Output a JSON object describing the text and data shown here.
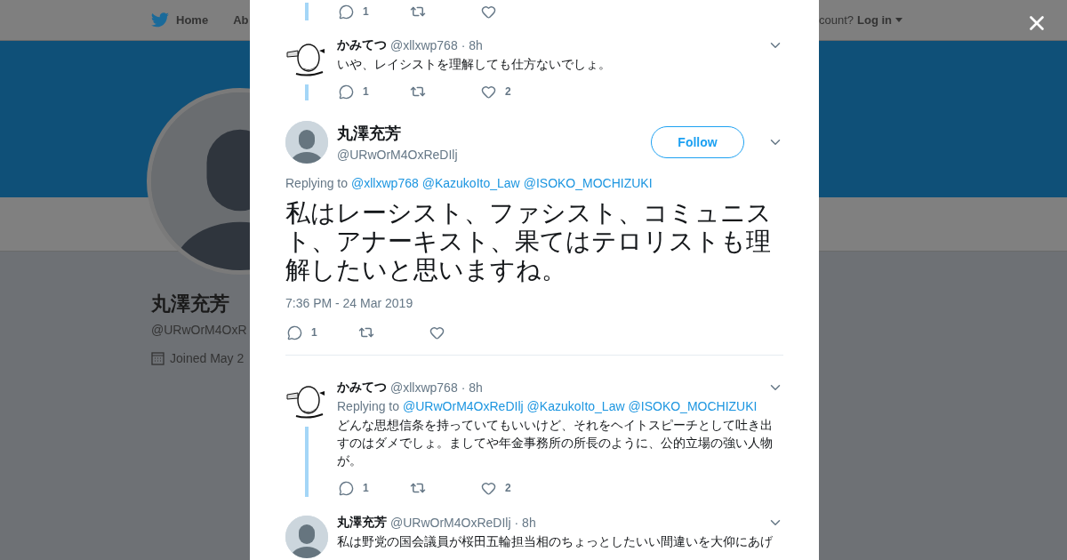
{
  "background_page": {
    "nav": {
      "home": "Home",
      "about": "Ab",
      "account_prompt": "count?",
      "login": "Log in"
    },
    "profile": {
      "name": "丸澤充芳",
      "handle": "@URwOrM4OxR",
      "joined": "Joined May 2"
    }
  },
  "tweets": [
    {
      "kind": "partial",
      "stats": {
        "replies": "1"
      },
      "thread_below": true
    },
    {
      "kind": "reply",
      "avatar": {
        "kind": "sketch"
      },
      "name": "かみてつ",
      "handle": "@xllxwp768",
      "time": "· 8h",
      "text": "いや、レイシストを理解しても仕方ないでしょ。",
      "stats": {
        "replies": "1",
        "likes": "2"
      },
      "thread_below": true
    },
    {
      "kind": "focus",
      "avatar": {
        "kind": "default"
      },
      "name": "丸澤充芳",
      "handle": "@URwOrM4OxReDIlj",
      "follow": "Follow",
      "replying_to": {
        "label": "Replying to",
        "users": [
          "@xllxwp768",
          "@KazukoIto_Law",
          "@ISOKO_MOCHIZUKI"
        ]
      },
      "text": "私はレーシスト、ファシスト、コミュニスト、アナーキスト、果てはテロリストも理解したいと思いますね。",
      "timestamp": "7:36 PM - 24 Mar 2019",
      "stats": {
        "replies": "1"
      }
    },
    {
      "kind": "reply",
      "avatar": {
        "kind": "sketch"
      },
      "name": "かみてつ",
      "handle": "@xllxwp768",
      "time": "· 8h",
      "replying_to": {
        "label": "Replying to",
        "users": [
          "@URwOrM4OxReDIlj",
          "@KazukoIto_Law",
          "@ISOKO_MOCHIZUKI"
        ]
      },
      "text": "どんな思想信条を持っていてもいいけど、それをヘイトスピーチとして吐き出すのはダメでしょ。ましてや年金事務所の所長のように、公的立場の強い人物が。",
      "stats": {
        "replies": "1",
        "likes": "2"
      },
      "thread_below": true
    },
    {
      "kind": "reply",
      "avatar": {
        "kind": "default"
      },
      "name": "丸澤充芳",
      "handle": "@URwOrM4OxReDIlj",
      "time": "· 8h",
      "text": "私は野党の国会議員が桜田五輪担当相のちょっとしたいい間違いを大仰にあげ",
      "thread_below": false
    }
  ]
}
